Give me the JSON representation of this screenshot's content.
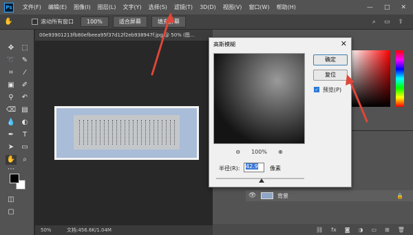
{
  "menubar": {
    "logo": "Ps",
    "items": [
      "文件(F)",
      "编辑(E)",
      "图像(I)",
      "图层(L)",
      "文字(Y)",
      "选择(S)",
      "滤镜(T)",
      "3D(D)",
      "视图(V)",
      "窗口(W)",
      "帮助(H)"
    ],
    "window_controls": [
      "—",
      "□",
      "✕"
    ]
  },
  "optionsbar": {
    "scroll_all_label": "滚动所有窗口",
    "zoom_value": "100%",
    "fit_screen": "适合屏幕",
    "fill_screen": "填充屏幕",
    "right_icons": [
      "⌕",
      "▭",
      "⇪"
    ]
  },
  "document": {
    "tab_title": "00e93901213fb80efbeea95f37d12f2eb938947f.jpg @ 50% (图...",
    "status_zoom": "50%",
    "status_doc": "文档:456.6K/1.04M"
  },
  "dialog": {
    "title": "高斯模糊",
    "close": "✕",
    "ok": "确定",
    "reset": "复位",
    "preview_label": "预览(P)",
    "zoom_out": "⊖",
    "zoom_value": "100%",
    "zoom_in": "⊕",
    "radius_label": "半径(R):",
    "radius_value": "42.9",
    "radius_unit": "像素"
  },
  "layers": {
    "background_name": "背景"
  },
  "colors": {
    "annotation_arrow": "#e0463a",
    "dialog_bg": "#f0f0f0",
    "ui_dark": "#535353"
  }
}
